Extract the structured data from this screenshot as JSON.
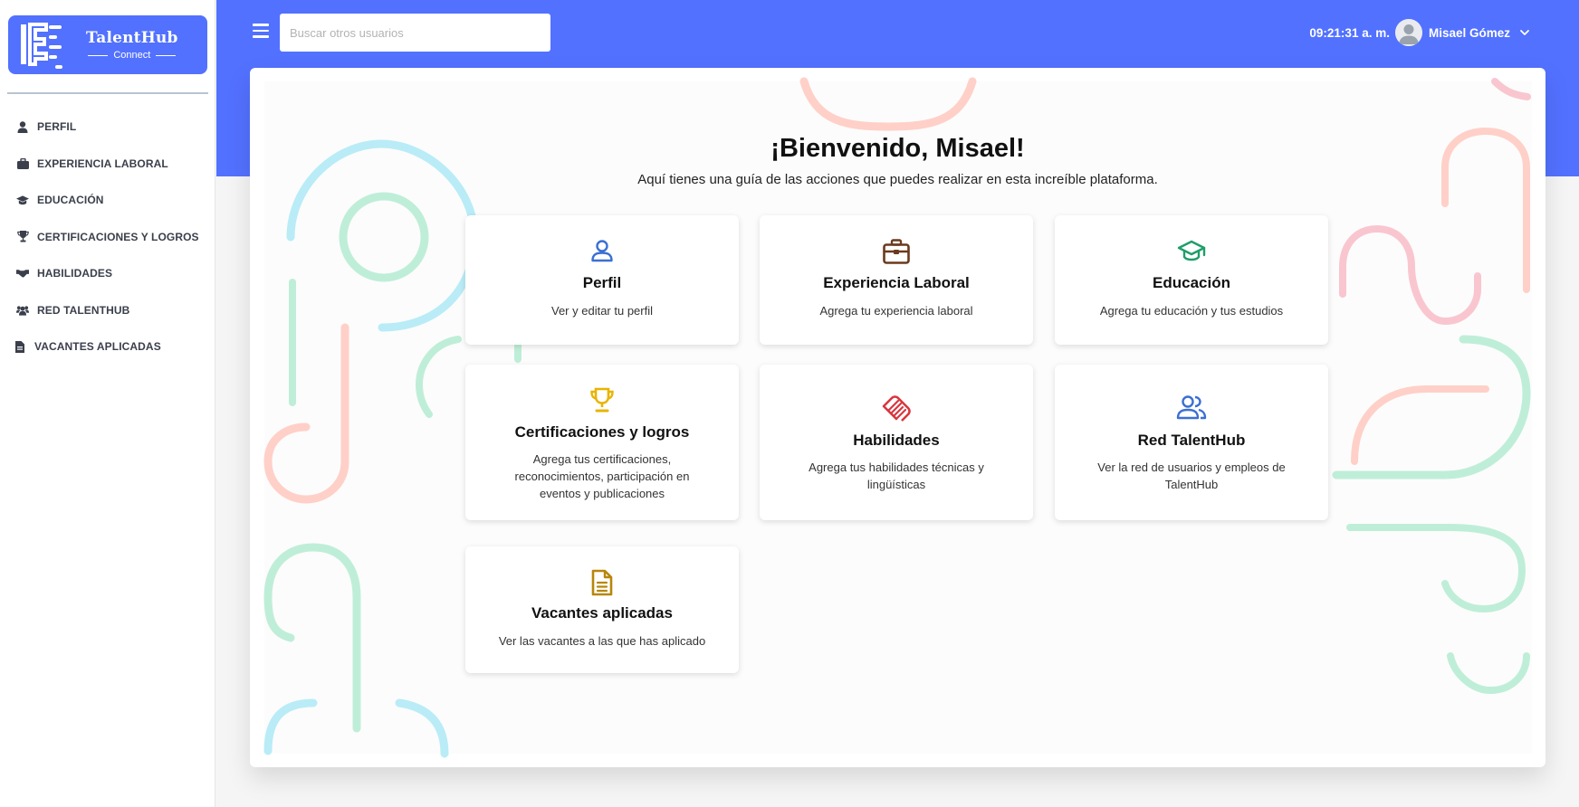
{
  "sidebar": {
    "logo": {
      "title": "TalentHub",
      "subtitle": "Connect"
    },
    "items": [
      {
        "label": "PERFIL",
        "icon": "user-icon"
      },
      {
        "label": "EXPERIENCIA LABORAL",
        "icon": "briefcase-icon"
      },
      {
        "label": "EDUCACIÓN",
        "icon": "graduation-cap-icon"
      },
      {
        "label": "CERTIFICACIONES Y LOGROS",
        "icon": "trophy-icon"
      },
      {
        "label": "HABILIDADES",
        "icon": "handshake-icon"
      },
      {
        "label": "RED TALENTHUB",
        "icon": "users-icon"
      },
      {
        "label": "VACANTES APLICADAS",
        "icon": "file-icon"
      }
    ]
  },
  "header": {
    "search_placeholder": "Buscar otros usuarios",
    "time": "09:21:31 a. m.",
    "user_name": "Misael Gómez"
  },
  "main": {
    "title": "¡Bienvenido, Misael!",
    "subtitle": "Aquí tienes una guía de las acciones que puedes realizar en esta increíble plataforma.",
    "tiles": [
      {
        "title": "Perfil",
        "desc": "Ver y editar tu perfil",
        "icon": "user-icon",
        "color": "#3b6fd4"
      },
      {
        "title": "Experiencia Laboral",
        "desc": "Agrega tu experiencia laboral",
        "icon": "briefcase-icon",
        "color": "#6b3a1e"
      },
      {
        "title": "Educación",
        "desc": "Agrega tu educación y tus estudios",
        "icon": "graduation-cap-icon",
        "color": "#1f9e6a"
      },
      {
        "title": "Certificaciones y logros",
        "desc": "Agrega tus certificaciones, reconocimientos, participación en eventos y publicaciones",
        "icon": "trophy-icon",
        "color": "#e8b400"
      },
      {
        "title": "Habilidades",
        "desc": "Agrega tus habilidades técnicas y lingüísticas",
        "icon": "handshake-icon",
        "color": "#d9363e"
      },
      {
        "title": "Red TalentHub",
        "desc": "Ver la red de usuarios y empleos de TalentHub",
        "icon": "users-icon",
        "color": "#3b6fd4"
      },
      {
        "title": "Vacantes aplicadas",
        "desc": "Ver las vacantes a las que has aplicado",
        "icon": "file-icon",
        "color": "#b8860b"
      }
    ]
  },
  "colors": {
    "primary": "#5271ff",
    "deco_blue": "#b9ecf6",
    "deco_green": "#bfeed8",
    "deco_pink": "#ffd0c8",
    "deco_rose": "#f9c6d0"
  }
}
